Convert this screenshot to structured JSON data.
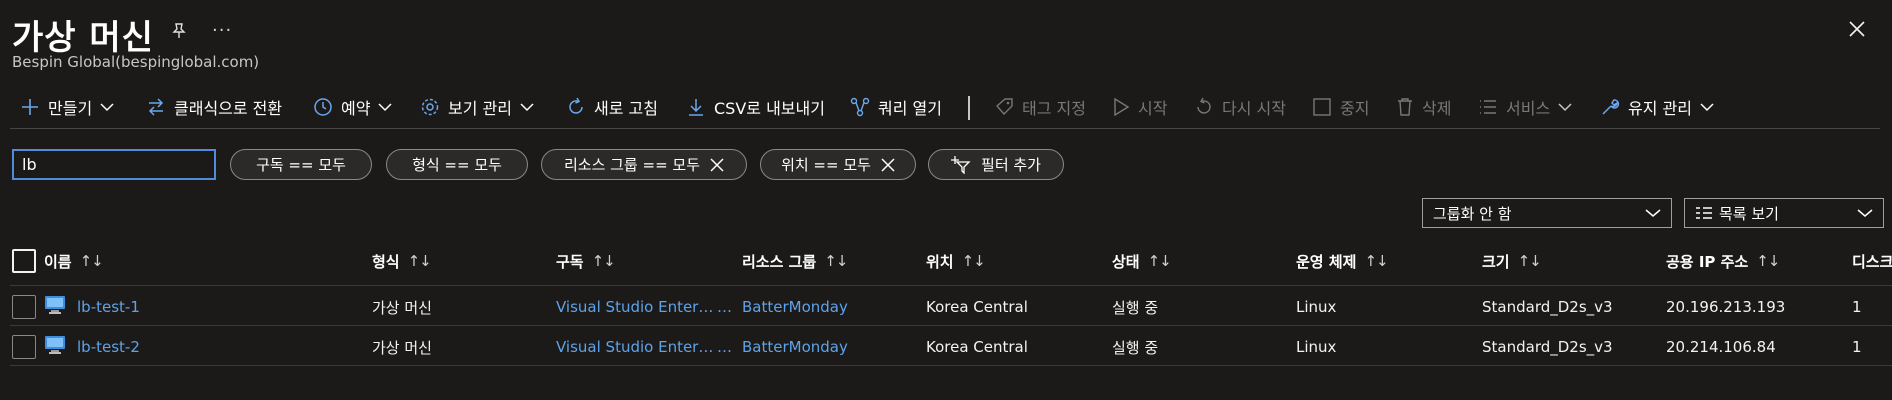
{
  "header": {
    "title": "가상 머신",
    "subtitle": "Bespin Global(bespinglobal.com)",
    "more": "···"
  },
  "toolbar": {
    "create": "만들기",
    "switch_classic": "클래식으로 전환",
    "reservation": "예약",
    "manage_view": "보기 관리",
    "refresh": "새로 고침",
    "export_csv": "CSV로 내보내기",
    "open_query": "쿼리 열기",
    "assign_tags": "태그 지정",
    "start": "시작",
    "restart": "다시 시작",
    "stop": "중지",
    "delete": "삭제",
    "services": "서비스",
    "maintenance": "유지 관리"
  },
  "filters": {
    "search_value": "lb",
    "subscription": "구독 == 모두",
    "type": "형식 == 모두",
    "resource_group": "리소스 그룹 == 모두",
    "location": "위치 == 모두",
    "add_filter": "필터 추가"
  },
  "view": {
    "grouping": "그룹화 안 함",
    "list_view": "목록 보기"
  },
  "table": {
    "columns": [
      "이름",
      "형식",
      "구독",
      "리소스 그룹",
      "위치",
      "상태",
      "운영 체제",
      "크기",
      "공용 IP 주소",
      "디스크"
    ],
    "sort_glyph": "↑↓",
    "rows": [
      {
        "name": "lb-test-1",
        "type": "가상 머신",
        "subscription": "Visual Studio Enterprise",
        "resource_group": "BatterMonday",
        "location": "Korea Central",
        "status": "실행 중",
        "os": "Linux",
        "size": "Standard_D2s_v3",
        "public_ip": "20.196.213.193",
        "disks": "1"
      },
      {
        "name": "lb-test-2",
        "type": "가상 머신",
        "subscription": "Visual Studio Enterprise",
        "resource_group": "BatterMonday",
        "location": "Korea Central",
        "status": "실행 중",
        "os": "Linux",
        "size": "Standard_D2s_v3",
        "public_ip": "20.214.106.84",
        "disks": "1"
      }
    ]
  },
  "colors": {
    "background": "#1b1a19",
    "link": "#5ea2e8",
    "accent": "#4f8cd9"
  }
}
